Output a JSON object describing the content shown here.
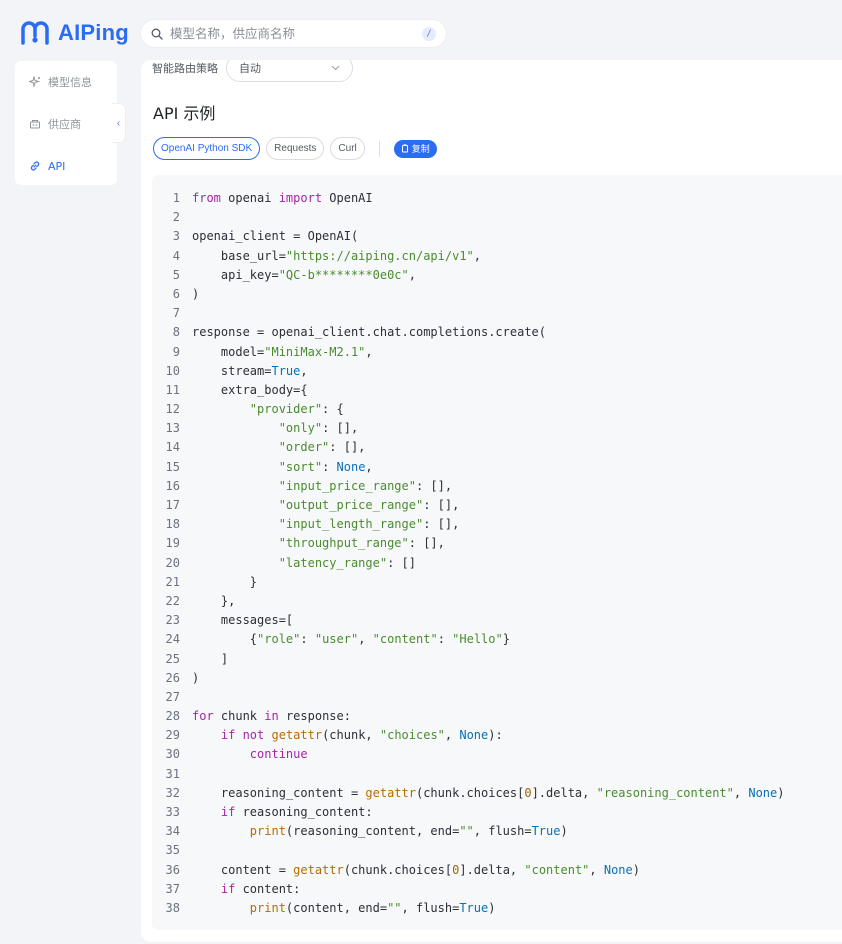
{
  "app": {
    "logo_text": "AIPing",
    "brand_color": "#2a6df4"
  },
  "search": {
    "placeholder": "模型名称，供应商名称",
    "shortcut": "/"
  },
  "sidebar": {
    "items": [
      {
        "label": "模型信息",
        "icon": "sparkle-icon",
        "active": false
      },
      {
        "label": "供应商",
        "icon": "provider-icon",
        "active": false
      },
      {
        "label": "API",
        "icon": "link-icon",
        "active": true
      }
    ],
    "collapse_glyph": "‹"
  },
  "main": {
    "route_label": "智能路由策略",
    "route_value": "自动",
    "section_title": "API 示例",
    "tabs": [
      {
        "label": "OpenAI Python SDK",
        "active": true
      },
      {
        "label": "Requests",
        "active": false
      },
      {
        "label": "Curl",
        "active": false
      }
    ],
    "copy_label": "复制"
  },
  "code": {
    "lines": [
      [
        {
          "t": "from",
          "c": "kw"
        },
        {
          "t": " openai "
        },
        {
          "t": "import",
          "c": "kw"
        },
        {
          "t": " OpenAI"
        }
      ],
      [],
      [
        {
          "t": "openai_client = OpenAI("
        }
      ],
      [
        {
          "t": "    base_url="
        },
        {
          "t": "\"https://aiping.cn/api/v1\"",
          "c": "str"
        },
        {
          "t": ","
        }
      ],
      [
        {
          "t": "    api_key="
        },
        {
          "t": "\"QC-b********0e0c\"",
          "c": "str"
        },
        {
          "t": ","
        }
      ],
      [
        {
          "t": ")"
        }
      ],
      [],
      [
        {
          "t": "response = openai_client.chat.completions.create("
        }
      ],
      [
        {
          "t": "    model="
        },
        {
          "t": "\"MiniMax-M2.1\"",
          "c": "str"
        },
        {
          "t": ","
        }
      ],
      [
        {
          "t": "    stream="
        },
        {
          "t": "True",
          "c": "const"
        },
        {
          "t": ","
        }
      ],
      [
        {
          "t": "    extra_body={"
        }
      ],
      [
        {
          "t": "        "
        },
        {
          "t": "\"provider\"",
          "c": "str"
        },
        {
          "t": ": {"
        }
      ],
      [
        {
          "t": "            "
        },
        {
          "t": "\"only\"",
          "c": "str"
        },
        {
          "t": ": [],"
        }
      ],
      [
        {
          "t": "            "
        },
        {
          "t": "\"order\"",
          "c": "str"
        },
        {
          "t": ": [],"
        }
      ],
      [
        {
          "t": "            "
        },
        {
          "t": "\"sort\"",
          "c": "str"
        },
        {
          "t": ": "
        },
        {
          "t": "None",
          "c": "const"
        },
        {
          "t": ","
        }
      ],
      [
        {
          "t": "            "
        },
        {
          "t": "\"input_price_range\"",
          "c": "str"
        },
        {
          "t": ": [],"
        }
      ],
      [
        {
          "t": "            "
        },
        {
          "t": "\"output_price_range\"",
          "c": "str"
        },
        {
          "t": ": [],"
        }
      ],
      [
        {
          "t": "            "
        },
        {
          "t": "\"input_length_range\"",
          "c": "str"
        },
        {
          "t": ": [],"
        }
      ],
      [
        {
          "t": "            "
        },
        {
          "t": "\"throughput_range\"",
          "c": "str"
        },
        {
          "t": ": [],"
        }
      ],
      [
        {
          "t": "            "
        },
        {
          "t": "\"latency_range\"",
          "c": "str"
        },
        {
          "t": ": []"
        }
      ],
      [
        {
          "t": "        }"
        }
      ],
      [
        {
          "t": "    },"
        }
      ],
      [
        {
          "t": "    messages=["
        }
      ],
      [
        {
          "t": "        {"
        },
        {
          "t": "\"role\"",
          "c": "str"
        },
        {
          "t": ": "
        },
        {
          "t": "\"user\"",
          "c": "str"
        },
        {
          "t": ", "
        },
        {
          "t": "\"content\"",
          "c": "str"
        },
        {
          "t": ": "
        },
        {
          "t": "\"Hello\"",
          "c": "str"
        },
        {
          "t": "}"
        }
      ],
      [
        {
          "t": "    ]"
        }
      ],
      [
        {
          "t": ")"
        }
      ],
      [],
      [
        {
          "t": "for",
          "c": "kw"
        },
        {
          "t": " chunk "
        },
        {
          "t": "in",
          "c": "kw"
        },
        {
          "t": " response:"
        }
      ],
      [
        {
          "t": "    "
        },
        {
          "t": "if not",
          "c": "kw"
        },
        {
          "t": " "
        },
        {
          "t": "getattr",
          "c": "fn"
        },
        {
          "t": "(chunk, "
        },
        {
          "t": "\"choices\"",
          "c": "str"
        },
        {
          "t": ", "
        },
        {
          "t": "None",
          "c": "const"
        },
        {
          "t": "):"
        }
      ],
      [
        {
          "t": "        "
        },
        {
          "t": "continue",
          "c": "kw"
        }
      ],
      [],
      [
        {
          "t": "    reasoning_content = "
        },
        {
          "t": "getattr",
          "c": "fn"
        },
        {
          "t": "(chunk.choices["
        },
        {
          "t": "0",
          "c": "num"
        },
        {
          "t": "].delta, "
        },
        {
          "t": "\"reasoning_content\"",
          "c": "str"
        },
        {
          "t": ", "
        },
        {
          "t": "None",
          "c": "const"
        },
        {
          "t": ")"
        }
      ],
      [
        {
          "t": "    "
        },
        {
          "t": "if",
          "c": "kw"
        },
        {
          "t": " reasoning_content:"
        }
      ],
      [
        {
          "t": "        "
        },
        {
          "t": "print",
          "c": "fn"
        },
        {
          "t": "(reasoning_content, end="
        },
        {
          "t": "\"\"",
          "c": "str"
        },
        {
          "t": ", flush="
        },
        {
          "t": "True",
          "c": "const"
        },
        {
          "t": ")"
        }
      ],
      [],
      [
        {
          "t": "    content = "
        },
        {
          "t": "getattr",
          "c": "fn"
        },
        {
          "t": "(chunk.choices["
        },
        {
          "t": "0",
          "c": "num"
        },
        {
          "t": "].delta, "
        },
        {
          "t": "\"content\"",
          "c": "str"
        },
        {
          "t": ", "
        },
        {
          "t": "None",
          "c": "const"
        },
        {
          "t": ")"
        }
      ],
      [
        {
          "t": "    "
        },
        {
          "t": "if",
          "c": "kw"
        },
        {
          "t": " content:"
        }
      ],
      [
        {
          "t": "        "
        },
        {
          "t": "print",
          "c": "fn"
        },
        {
          "t": "(content, end="
        },
        {
          "t": "\"\"",
          "c": "str"
        },
        {
          "t": ", flush="
        },
        {
          "t": "True",
          "c": "const"
        },
        {
          "t": ")"
        }
      ]
    ]
  }
}
